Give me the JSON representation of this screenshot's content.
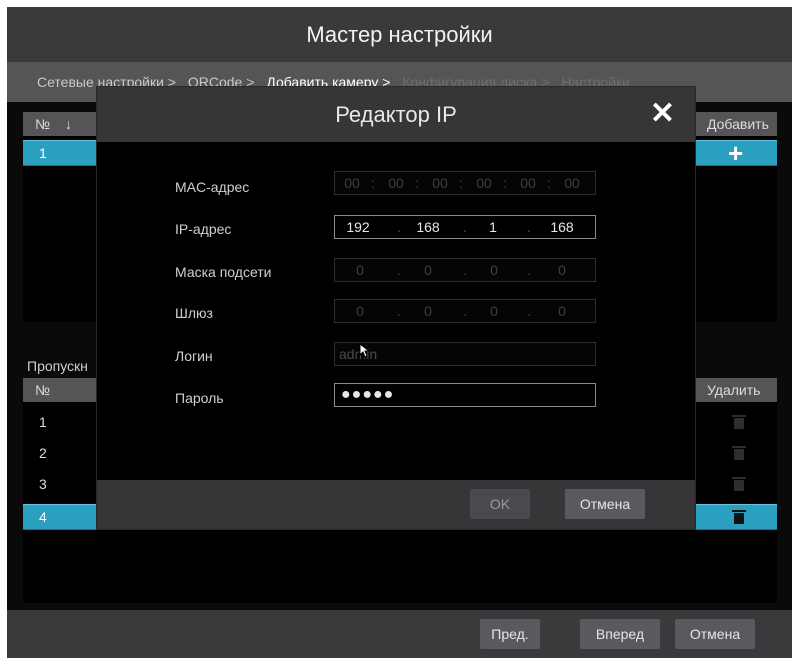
{
  "window": {
    "title": "Мастер настройки"
  },
  "steps": [
    {
      "label": "Сетевые настройки >",
      "state": "done"
    },
    {
      "label": "QRCode >",
      "state": "done"
    },
    {
      "label": "Добавить камеру >",
      "state": "active"
    },
    {
      "label": "Конфигурация диска >",
      "state": "future"
    },
    {
      "label": "Настройки",
      "state": "future"
    }
  ],
  "top_table": {
    "headers": {
      "num": "№",
      "sort_arrow": "↓",
      "add": "Добавить"
    },
    "rows": [
      {
        "num": "1"
      }
    ]
  },
  "bottom_section": {
    "label": "Пропускн",
    "headers": {
      "num": "№",
      "delete": "Удалить"
    },
    "rows": [
      {
        "num": "1"
      },
      {
        "num": "2"
      },
      {
        "num": "3"
      },
      {
        "num": "4",
        "selected": true
      }
    ]
  },
  "footer": {
    "prev": "Пред.",
    "next": "Вперед",
    "cancel": "Отмена"
  },
  "modal": {
    "title": "Редактор IP",
    "fields": {
      "mac": {
        "label": "MAC-адрес",
        "segments": [
          "00",
          "00",
          "00",
          "00",
          "00",
          "00"
        ],
        "separator": ":"
      },
      "ip": {
        "label": "IP-адрес",
        "segments": [
          "192",
          "168",
          "1",
          "168"
        ],
        "separator": "."
      },
      "mask": {
        "label": "Маска подсети",
        "segments": [
          "0",
          "0",
          "0",
          "0"
        ],
        "separator": "."
      },
      "gateway": {
        "label": "Шлюз",
        "segments": [
          "0",
          "0",
          "0",
          "0"
        ],
        "separator": "."
      },
      "login": {
        "label": "Логин",
        "value": "admin"
      },
      "password": {
        "label": "Пароль",
        "value": "●●●●●"
      }
    },
    "ok": "OK",
    "cancel": "Отмена"
  },
  "colors": {
    "selected_row": "#2a9fbf",
    "title_bar": "#3a3a3c",
    "button": "#5a5a5e"
  },
  "icons": {
    "close": "close-icon",
    "add": "plus-icon",
    "delete": "trash-icon",
    "sort": "sort-down-icon"
  }
}
